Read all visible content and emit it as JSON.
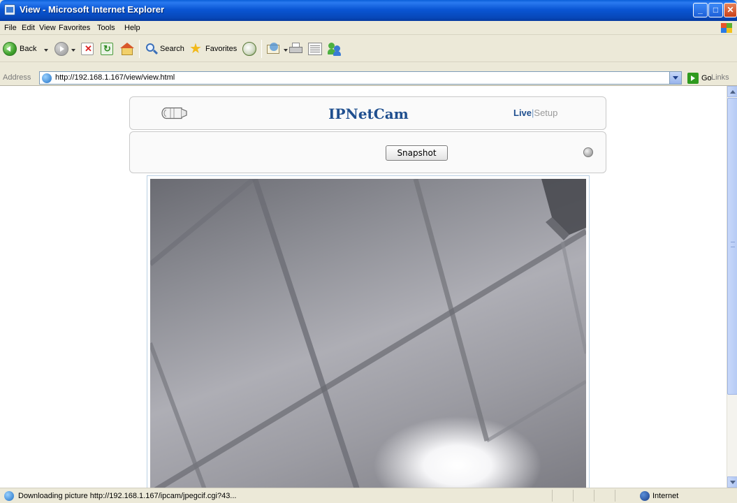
{
  "window": {
    "title": "View - Microsoft Internet Explorer"
  },
  "menu": {
    "items": [
      "File",
      "Edit",
      "View",
      "Favorites",
      "Tools",
      "Help"
    ]
  },
  "toolbar": {
    "back_label": "Back",
    "search_label": "Search",
    "favorites_label": "Favorites"
  },
  "address": {
    "label": "Address",
    "url": "http://192.168.1.167/view/view.html",
    "go_label": "Go",
    "links_label": "Links"
  },
  "page": {
    "title": "IPNetCam",
    "nav_live": "Live",
    "nav_separator": "|",
    "nav_setup": "Setup",
    "snapshot_label": "Snapshot"
  },
  "status": {
    "text": "Downloading picture http://192.168.1.167/ipcam/jpegcif.cgi?43...",
    "zone": "Internet"
  },
  "colors": {
    "title_bar": "#0a56d4",
    "brand_text": "#1f4f8f"
  }
}
